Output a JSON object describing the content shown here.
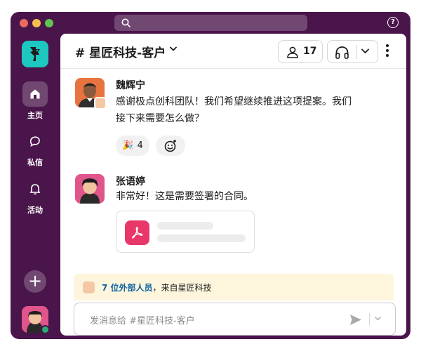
{
  "channel": {
    "name": "# 星匠科技-客户",
    "member_count": "17"
  },
  "rail": {
    "items": [
      {
        "label": "主页",
        "icon": "home-icon"
      },
      {
        "label": "私信",
        "icon": "dm-icon"
      },
      {
        "label": "活动",
        "icon": "bell-icon"
      }
    ]
  },
  "messages": [
    {
      "sender": "魏辉宁",
      "text_line1": "感谢极点创科团队！我们希望继续推进这项提案。我们",
      "text_line2": "接下来需要怎么做？",
      "reaction_emoji": "🎉",
      "reaction_count": "4"
    },
    {
      "sender": "张语婷",
      "text": "非常好！这是需要签署的合同。",
      "attachment_icon": "pdf-icon"
    }
  ],
  "banner": {
    "link_text": "7 位外部人员",
    "rest_text": "，来自星匠科技"
  },
  "composer": {
    "placeholder": "发消息给 #星匠科技-客户"
  },
  "colors": {
    "sidebar": "#4a154b",
    "accent_link": "#1264a3",
    "pdf": "#e8386a",
    "banner_bg": "#fdf6dd"
  }
}
